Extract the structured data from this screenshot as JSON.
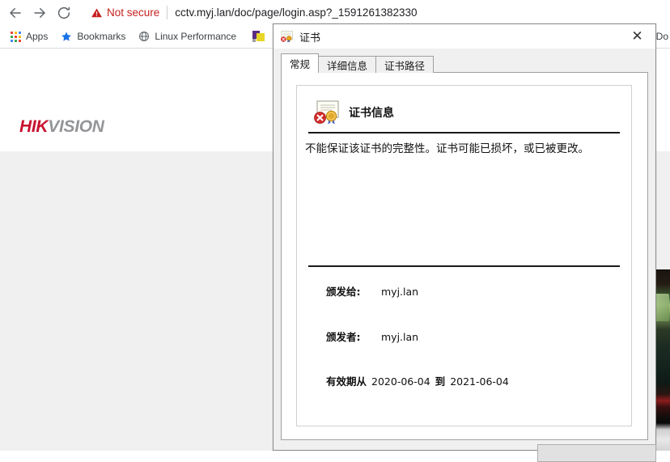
{
  "browser": {
    "nav": {
      "back_icon": "arrow-left-icon",
      "forward_icon": "arrow-right-icon",
      "reload_icon": "reload-icon"
    },
    "omnibox": {
      "security_icon": "warning-triangle-icon",
      "security_label": "Not secure",
      "url": "cctv.myj.lan/doc/page/login.asp?_1591261382330"
    },
    "bookmarks": [
      {
        "icon": "apps-grid-icon",
        "label": "Apps"
      },
      {
        "icon": "star-icon",
        "label": "Bookmarks"
      },
      {
        "icon": "globe-icon",
        "label": "Linux Performance"
      },
      {
        "icon": "colored-square-icon",
        "label": ""
      },
      {
        "icon": "document-icon",
        "label": "Do"
      }
    ]
  },
  "page": {
    "logo_primary": "HIK",
    "logo_secondary": "VISION"
  },
  "dialog": {
    "title": "证书",
    "title_icon": "certificate-icon",
    "close_icon": "close-icon",
    "close_glyph": "✕",
    "tabs": [
      {
        "label": "常规",
        "active": true
      },
      {
        "label": "详细信息",
        "active": false
      },
      {
        "label": "证书路径",
        "active": false
      }
    ],
    "cert": {
      "heading_icon": "certificate-error-icon",
      "heading": "证书信息",
      "warning": "不能保证该证书的完整性。证书可能已损坏，或已被更改。",
      "issued_to_label": "颁发给:",
      "issued_to_value": "myj.lan",
      "issuer_label": "颁发者:",
      "issuer_value": "myj.lan",
      "validity_from_label": "有效期从",
      "validity_from": "2020-06-04",
      "validity_to_label": "到",
      "validity_to": "2021-06-04"
    }
  },
  "colors": {
    "not_secure_red": "#c5221f",
    "logo_red": "#c8102e",
    "logo_gray": "#939598",
    "dialog_bg": "#f0f0f0"
  }
}
